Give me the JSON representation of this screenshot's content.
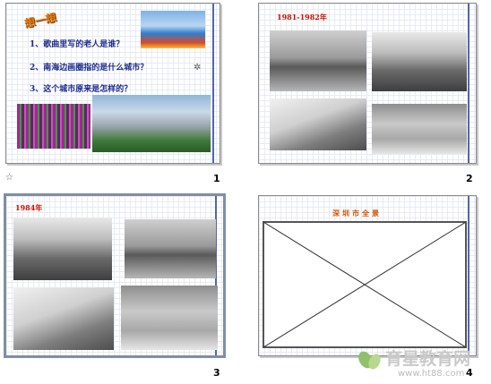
{
  "slides": [
    {
      "number": "1",
      "wordart": "想一想",
      "questions": [
        "1、歌曲里写的老人是谁？",
        "2、南海边画圈指的是什么城市？",
        "3、这个城市原来是怎样的？"
      ],
      "transition_icon": "☆"
    },
    {
      "number": "2",
      "title": "1981-1982年"
    },
    {
      "number": "3",
      "title": "1984年"
    },
    {
      "number": "4",
      "title": "深圳市全景"
    }
  ],
  "watermark": {
    "brand": "育星教育网",
    "url": "www.ht88.com"
  },
  "colors": {
    "question_text": "#1b2a8a",
    "slide_title": "#cc1100",
    "accent_line": "#5566aa",
    "wordart": "#e07a10"
  }
}
